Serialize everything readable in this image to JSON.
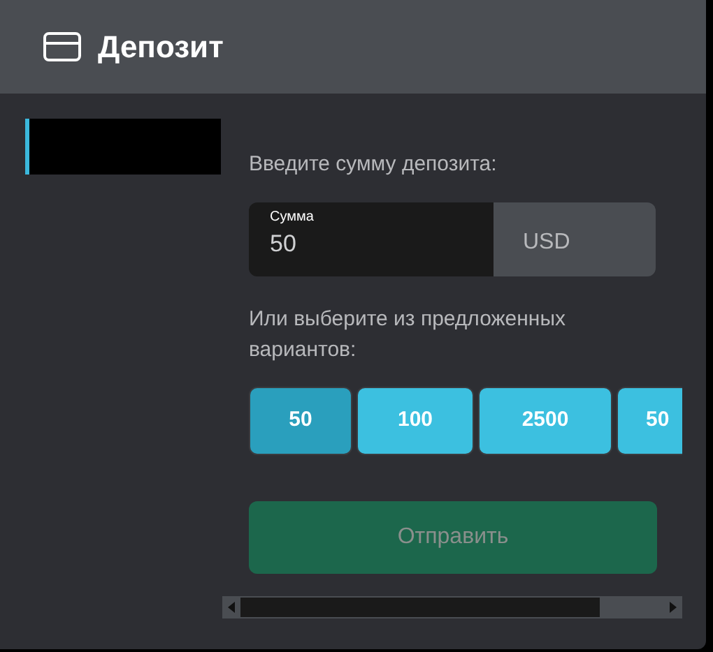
{
  "window": {
    "title": "Депозит"
  },
  "sidebar": {
    "items": [
      {
        "selected": true
      }
    ]
  },
  "form": {
    "prompt": "Введите сумму депозита:",
    "amount": {
      "label": "Сумма",
      "value": "50"
    },
    "currency": "USD",
    "presets_prompt": "Или выберите из предложенных вариантов:",
    "presets": [
      {
        "label": "50",
        "selected": true
      },
      {
        "label": "100",
        "selected": false
      },
      {
        "label": "2500",
        "selected": false
      },
      {
        "label": "50",
        "selected": false
      }
    ],
    "submit": {
      "label": "Отправить",
      "disabled": true
    }
  }
}
